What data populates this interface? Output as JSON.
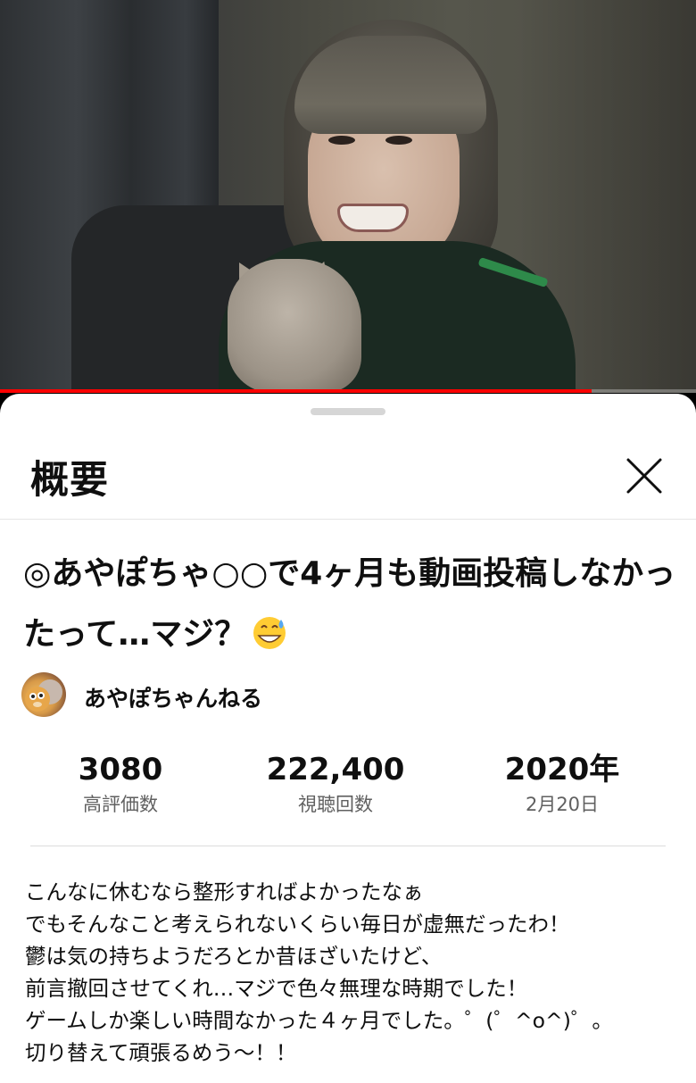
{
  "player": {
    "progress": 0.85,
    "progress_color": "#ff0000"
  },
  "sheet": {
    "title": "概要",
    "close_icon": "close-icon"
  },
  "video": {
    "title_text": "◎あやぽちゃ○○で4ヶ月も動画投稿しなかったって…マジ？",
    "title_emoji": "grinning-face-with-sweat-emoji"
  },
  "channel": {
    "name": "あやぽちゃんねる",
    "avatar_icon": "channel-avatar"
  },
  "stats": {
    "likes_value": "3080",
    "likes_label": "高評価数",
    "views_value": "222,400",
    "views_label": "視聴回数",
    "year_value": "2020年",
    "date_label": "2月20日"
  },
  "description": {
    "lines": [
      "こんなに休むなら整形すればよかったなぁ",
      "でもそんなこと考えられないくらい毎日が虚無だったわ！",
      "鬱は気の持ちようだろとか昔ほざいたけど、",
      "前言撤回させてくれ…マジで色々無理な時期でした！",
      "ゲームしか楽しい時間なかった４ヶ月でした。゜(゜^o^)゜。",
      "切り替えて頑張るめう〜！！"
    ]
  },
  "colors": {
    "accent": "#ff0000",
    "text_primary": "#0f0f0f",
    "text_secondary": "#606060"
  }
}
